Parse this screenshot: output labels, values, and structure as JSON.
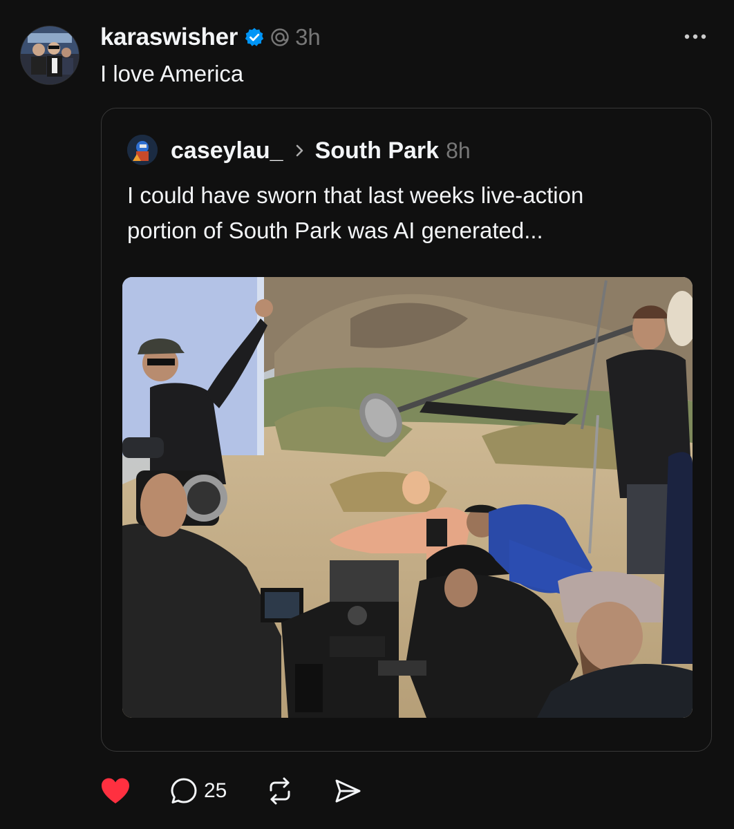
{
  "post": {
    "username": "karaswisher",
    "time": "3h",
    "text": "I love America",
    "verified": true,
    "icons": [
      "verified-badge-icon",
      "threads-icon",
      "more-icon"
    ]
  },
  "quoted_post": {
    "username": "caseylau_",
    "community": "South Park",
    "time": "8h",
    "text_line1": "I could have sworn that last weeks live-action",
    "text_line2": "portion of South Park was AI generated...",
    "image_description_icon": "film-set-photo"
  },
  "actions": {
    "liked": true,
    "reply_count": "25",
    "icons": [
      "heart-icon",
      "reply-icon",
      "repost-icon",
      "share-icon"
    ]
  },
  "colors": {
    "background": "#101010",
    "text": "#f3f5f7",
    "muted": "#777777",
    "like": "#ff3040",
    "verified": "#0095f6",
    "border": "#383838"
  }
}
